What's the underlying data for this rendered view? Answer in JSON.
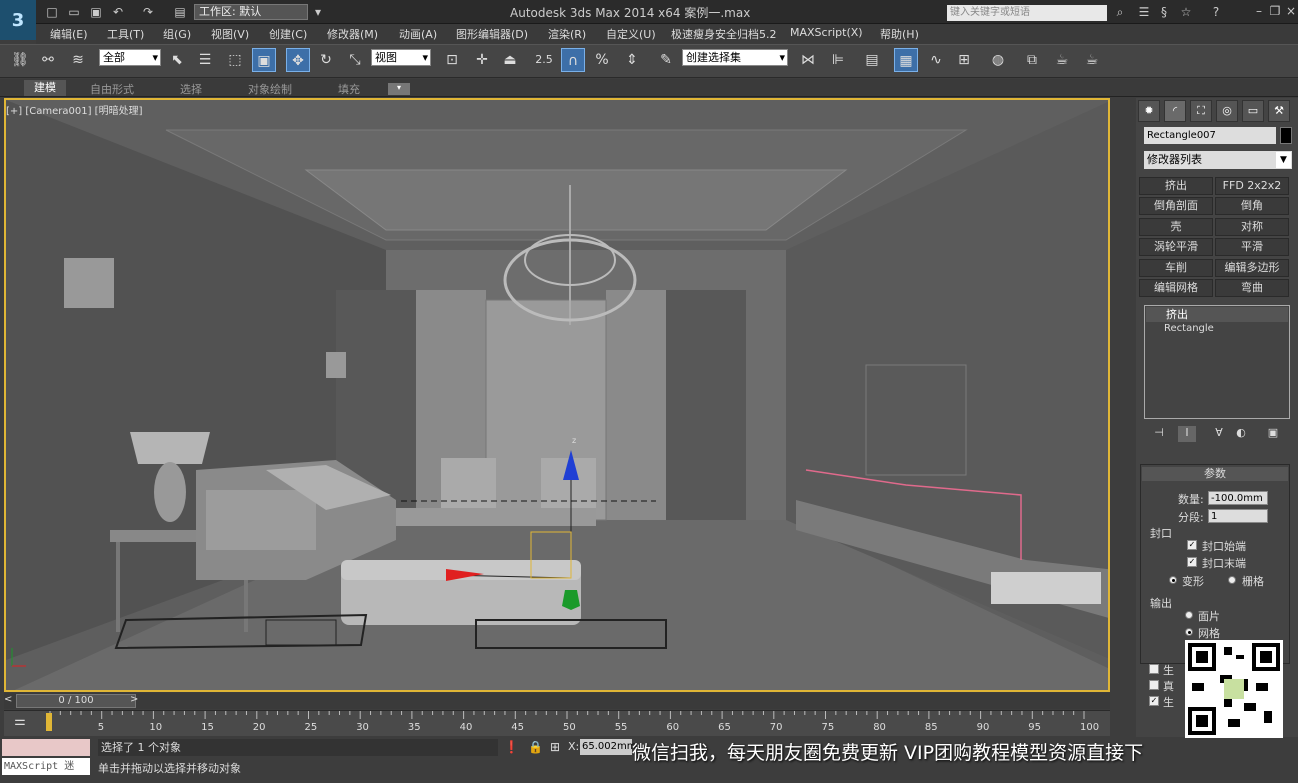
{
  "titlebar": {
    "workspace": "工作区: 默认",
    "title": "Autodesk 3ds Max  2014 x64        案例一.max",
    "search_placeholder": "键入关键字或短语"
  },
  "menu": [
    "编辑(E)",
    "工具(T)",
    "组(G)",
    "视图(V)",
    "创建(C)",
    "修改器(M)",
    "动画(A)",
    "图形编辑器(D)",
    "渲染(R)",
    "自定义(U)",
    "极速瘦身安全归档5.2",
    "MAXScript(X)",
    "帮助(H)"
  ],
  "toolbar": {
    "filter_select": "全部",
    "ref_coord": "视图",
    "snap_angle": "2.5",
    "named_sel": "创建选择集"
  },
  "ribbon": {
    "tabs": [
      "建模",
      "自由形式",
      "选择",
      "对象绘制",
      "填充"
    ]
  },
  "viewport": {
    "label": "[+] [Camera001] [明暗处理]"
  },
  "cmdpanel": {
    "object_name": "Rectangle007",
    "modifier_list": "修改器列表",
    "modifier_buttons": [
      [
        "挤出",
        "FFD 2x2x2"
      ],
      [
        "倒角剖面",
        "倒角"
      ],
      [
        "壳",
        "对称"
      ],
      [
        "涡轮平滑",
        "平滑"
      ],
      [
        "车削",
        "编辑多边形"
      ],
      [
        "编辑网格",
        "弯曲"
      ]
    ],
    "stack": [
      "挤出",
      "Rectangle"
    ],
    "params": {
      "title": "参数",
      "amount_label": "数量:",
      "amount": "-100.0mm",
      "segments_label": "分段:",
      "segments": "1",
      "capping_title": "封口",
      "cap_start": "封口始端",
      "cap_end": "封口末端",
      "morph": "变形",
      "grid": "栅格",
      "output_title": "输出",
      "patch": "面片",
      "mesh": "网格",
      "gen_1": "生",
      "gen_2": "真",
      "gen_3": "生"
    }
  },
  "timeline": {
    "frame": "0 / 100",
    "ticks": [
      "5",
      "10",
      "15",
      "20",
      "25",
      "30",
      "35",
      "40",
      "45",
      "50",
      "55",
      "60",
      "65",
      "70",
      "75",
      "80",
      "85",
      "90",
      "95",
      "100"
    ]
  },
  "status": {
    "maxscript": "MAXScript 迷",
    "selected": "选择了 1 个对象",
    "prompt": "单击并拖动以选择并移动对象",
    "x_label": "X:",
    "x_value": "65.002mm"
  },
  "watermark": "微信扫我，每天朋友圈免费更新 VIP团购教程模型资源直接下"
}
